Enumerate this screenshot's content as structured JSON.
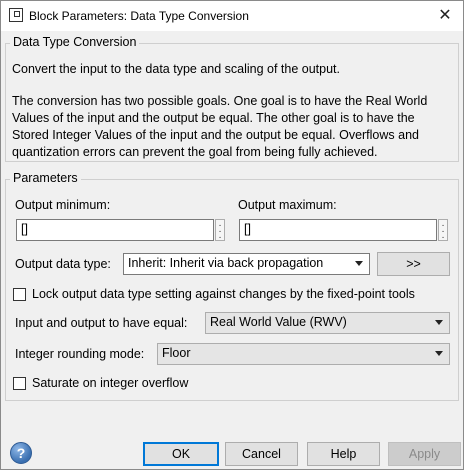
{
  "window": {
    "title": "Block Parameters: Data Type Conversion",
    "close_glyph": "✕"
  },
  "description": {
    "group_title": "Data Type Conversion",
    "line1": "Convert the input to the data type and scaling of the output.",
    "para2": [
      "The conversion has two possible goals. One goal is to have the Real World",
      "Values of the input and the output be equal.  The other goal is to have the",
      "Stored Integer Values of the input and the output be equal.  Overflows and",
      "quantization errors can prevent the goal from being fully achieved."
    ]
  },
  "parameters": {
    "group_title": "Parameters",
    "output_minimum": {
      "label": "Output minimum:",
      "value": "[]"
    },
    "output_maximum": {
      "label": "Output maximum:",
      "value": "[]"
    },
    "output_data_type": {
      "label": "Output data type:",
      "selected": "Inherit: Inherit via back propagation",
      "assistant_button": ">>"
    },
    "lock_checkbox": {
      "label": "Lock output data type setting against changes by the fixed-point tools",
      "checked": false
    },
    "equal_mode": {
      "label": "Input and output to have equal:",
      "selected": "Real World Value (RWV)"
    },
    "rounding_mode": {
      "label": "Integer rounding mode:",
      "selected": "Floor"
    },
    "saturate_checkbox": {
      "label": "Saturate on integer overflow",
      "checked": false
    }
  },
  "footer": {
    "help_icon": "question-mark-icon",
    "help_glyph": "?",
    "ok": "OK",
    "cancel": "Cancel",
    "help": "Help",
    "apply": "Apply"
  },
  "colors": {
    "accent": "#0078d7",
    "background": "#f0f0f0"
  }
}
